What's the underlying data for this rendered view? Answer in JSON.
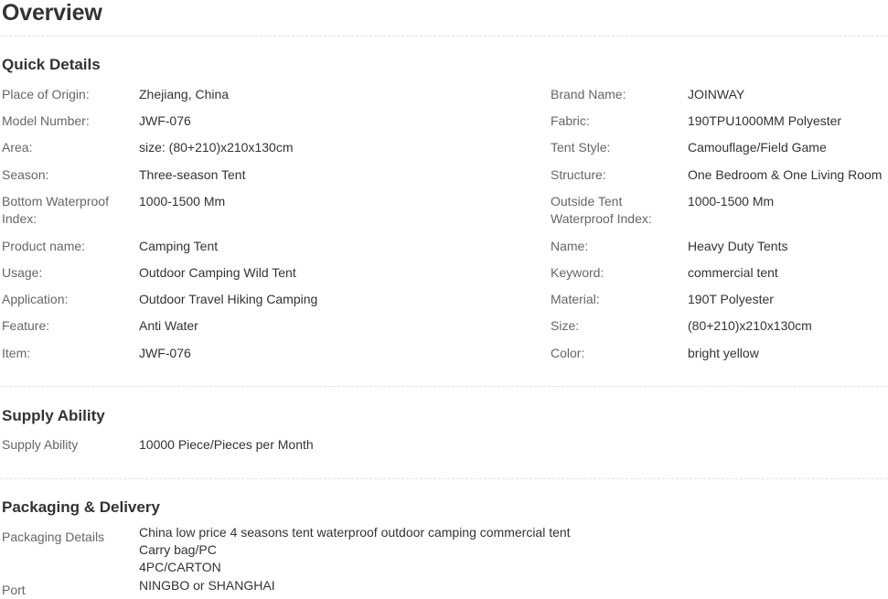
{
  "overview": {
    "title": "Overview"
  },
  "quick_details": {
    "title": "Quick Details",
    "rows": [
      {
        "left_label": "Place of Origin:",
        "left_value": "Zhejiang, China",
        "right_label": "Brand Name:",
        "right_value": "JOINWAY"
      },
      {
        "left_label": "Model Number:",
        "left_value": "JWF-076",
        "right_label": "Fabric:",
        "right_value": "190TPU1000MM Polyester"
      },
      {
        "left_label": "Area:",
        "left_value": "size: (80+210)x210x130cm",
        "right_label": "Tent Style:",
        "right_value": "Camouflage/Field Game"
      },
      {
        "left_label": "Season:",
        "left_value": "Three-season Tent",
        "right_label": "Structure:",
        "right_value": "One Bedroom & One Living Room"
      },
      {
        "left_label": "Bottom Waterproof Index:",
        "left_value": "1000-1500 Mm",
        "right_label": "Outside Tent Waterproof Index:",
        "right_value": "1000-1500 Mm"
      },
      {
        "left_label": "Product name:",
        "left_value": "Camping Tent",
        "right_label": "Name:",
        "right_value": "Heavy Duty Tents"
      },
      {
        "left_label": "Usage:",
        "left_value": "Outdoor Camping Wild Tent",
        "right_label": "Keyword:",
        "right_value": "commercial tent"
      },
      {
        "left_label": "Application:",
        "left_value": "Outdoor Travel Hiking Camping",
        "right_label": "Material:",
        "right_value": "190T Polyester"
      },
      {
        "left_label": "Feature:",
        "left_value": "Anti Water",
        "right_label": "Size:",
        "right_value": "(80+210)x210x130cm"
      },
      {
        "left_label": "Item:",
        "left_value": "JWF-076",
        "right_label": "Color:",
        "right_value": "bright yellow"
      }
    ]
  },
  "supply_ability": {
    "title": "Supply Ability",
    "label": "Supply Ability",
    "value": "10000 Piece/Pieces per Month"
  },
  "packaging_delivery": {
    "title": "Packaging & Delivery",
    "details_label": "Packaging Details",
    "details_lines": [
      "China low price 4 seasons tent waterproof outdoor camping commercial tent",
      "Carry bag/PC",
      "4PC/CARTON"
    ],
    "port_label": "Port",
    "port_value": "NINGBO or SHANGHAI"
  }
}
